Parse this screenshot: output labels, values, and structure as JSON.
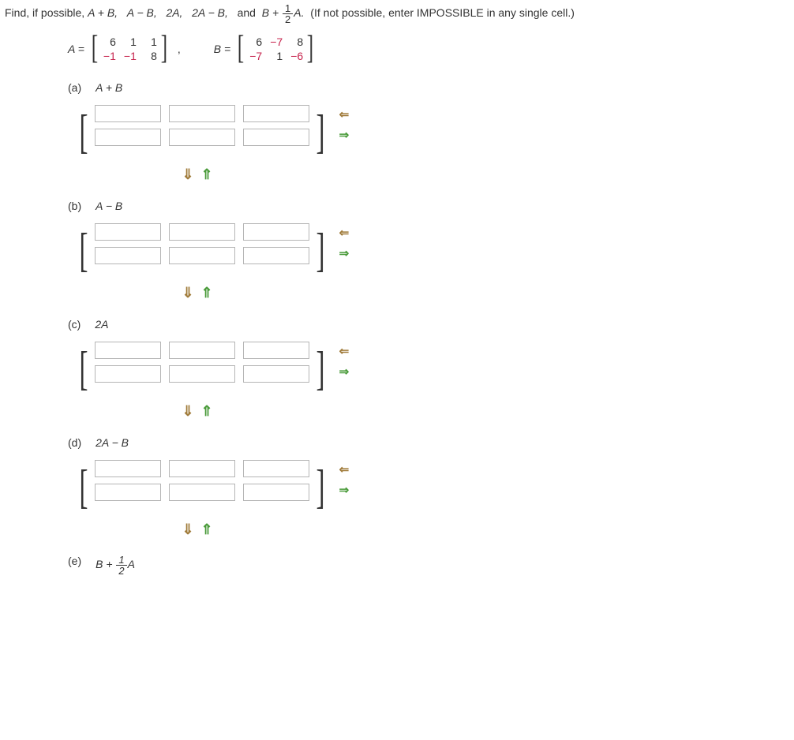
{
  "prompt": {
    "lead": "Find, if possible,  ",
    "e1": "A + B,",
    "e2": "A − B,",
    "e3": "2A,",
    "e4": "2A − B,",
    "and": "and",
    "e5_pre": "B +",
    "e5_frac_num": "1",
    "e5_frac_den": "2",
    "e5_post": "A.",
    "hint": "(If not possible, enter IMPOSSIBLE in any single cell.)"
  },
  "matrixA": {
    "label": "A =",
    "rows": [
      [
        "6",
        "1",
        "1"
      ],
      [
        "−1",
        "−1",
        "8"
      ]
    ],
    "neg": [
      [
        false,
        false,
        false
      ],
      [
        true,
        true,
        false
      ]
    ]
  },
  "comma": ",",
  "matrixB": {
    "label": "B =",
    "rows": [
      [
        "6",
        "−7",
        "8"
      ],
      [
        "−7",
        "1",
        "−6"
      ]
    ],
    "neg": [
      [
        false,
        true,
        false
      ],
      [
        true,
        false,
        true
      ]
    ]
  },
  "parts": [
    {
      "key": "a",
      "label": "(a)",
      "expr": "A + B"
    },
    {
      "key": "b",
      "label": "(b)",
      "expr": "A − B"
    },
    {
      "key": "c",
      "label": "(c)",
      "expr": "2A"
    },
    {
      "key": "d",
      "label": "(d)",
      "expr": "2A − B"
    },
    {
      "key": "e",
      "label": "(e)",
      "expr_html": true
    }
  ],
  "e_expr": {
    "pre": "B +",
    "num": "1",
    "den": "2",
    "post": "A"
  },
  "arrows": {
    "left": "⇐",
    "right": "⇒",
    "down": "⇓",
    "up": "⇑"
  }
}
